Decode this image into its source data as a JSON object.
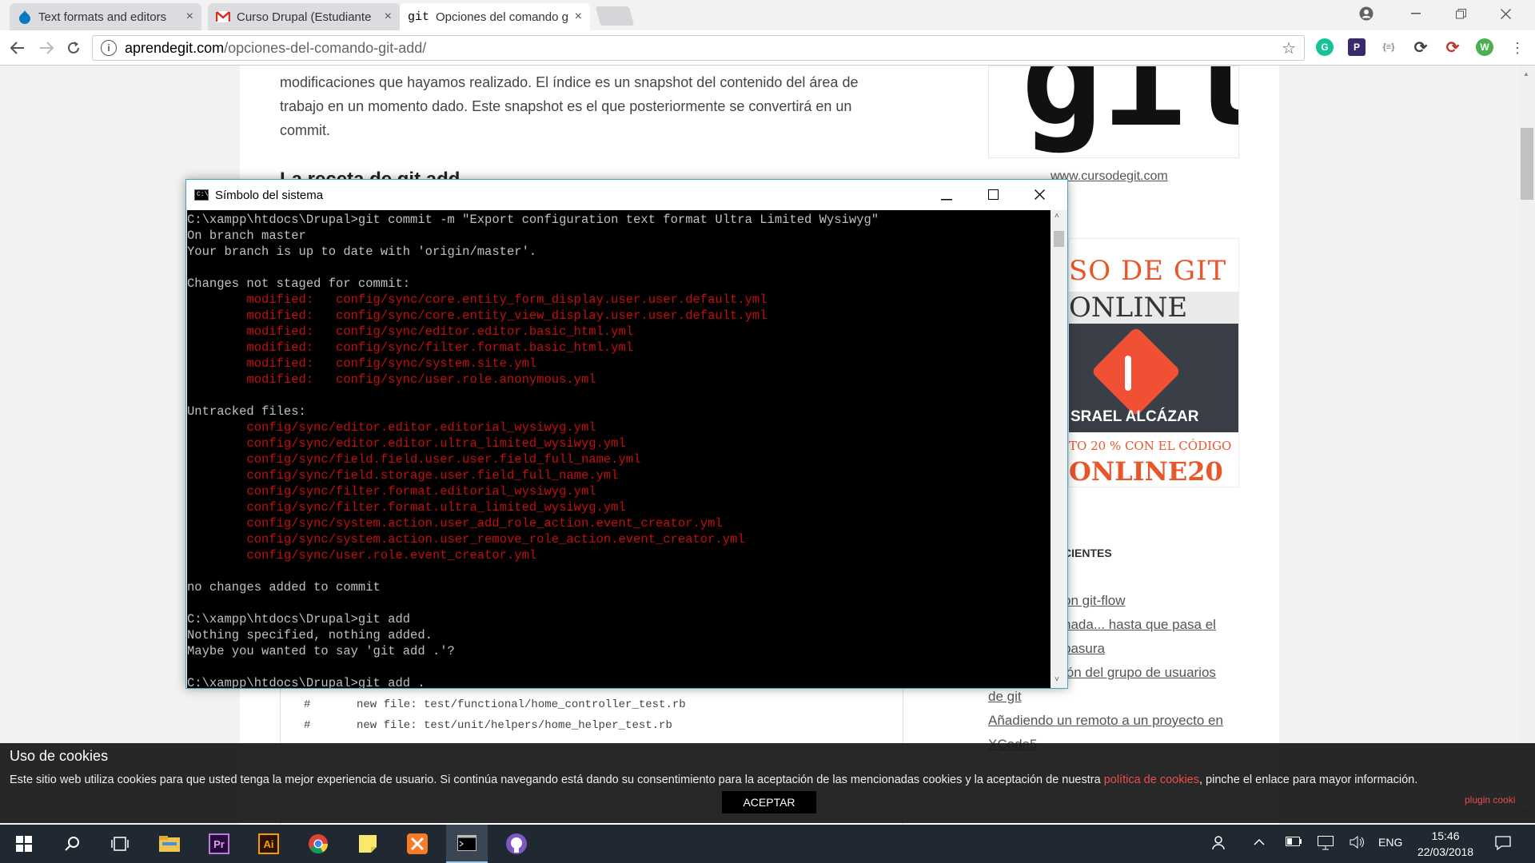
{
  "browser": {
    "tabs": [
      {
        "title": "Text formats and editors",
        "favicon": "drupal-icon",
        "color": "#0678be"
      },
      {
        "title": "Curso Drupal (Estudiante",
        "favicon": "gmail-icon",
        "color": "#d93025"
      },
      {
        "title": "Opciones del comando git",
        "favicon": "git-icon",
        "prefix": "git",
        "active": true
      }
    ],
    "close_glyph": "×",
    "url_host": "aprendegit.com",
    "url_path": "/opciones-del-comando-git-add/",
    "extensions": [
      {
        "name": "grammarly-icon",
        "glyph": "G",
        "color": "#15c39a"
      },
      {
        "name": "p-extension-icon",
        "glyph": "P",
        "color": "#3b2a6b"
      },
      {
        "name": "json-icon",
        "glyph": "{≡}",
        "color": "#888"
      },
      {
        "name": "sync-icon",
        "glyph": "⟳",
        "color": "#555"
      },
      {
        "name": "sync-red-icon",
        "glyph": "⟳",
        "color": "#c0392b"
      },
      {
        "name": "wordpress-icon",
        "glyph": "W",
        "color": "#4caf50"
      }
    ]
  },
  "article": {
    "lines": [
      "modificaciones que hayamos realizado. El índice es un snapshot del contenido del área de",
      "trabajo en un momento dado. Este snapshot es el que posteriormente se convertirá en un",
      "commit."
    ],
    "heading_partial": "La receta de git add",
    "code_lines": [
      {
        "hash": "#",
        "text": "new file: test/functional/home_controller_test.rb"
      },
      {
        "hash": "#",
        "text": "new file: test/unit/helpers/home_helper_test.rb"
      },
      {
        "hash": "#",
        "text": ""
      }
    ]
  },
  "sidebar": {
    "logo_text": "git",
    "site_link": "www.cursodegit.com",
    "promo": {
      "line1": "SO DE GIT",
      "line2": "ONLINE",
      "author": "SRAEL ALCÁZAR",
      "discount": "TO 20 % CON EL CÓDIGO",
      "code": "ONLINE20"
    },
    "section_title": "CIENTES",
    "links": [
      "on git-flow",
      "nada... hasta que pasa el",
      "basura",
      "ión del grupo de usuarios",
      "de git",
      "Añadiendo un remoto a un proyecto en",
      "XCode5"
    ]
  },
  "cookie": {
    "title": "Uso de cookies",
    "text_before": "Este sitio web utiliza cookies para que usted tenga la mejor experiencia de usuario. Si continúa navegando está dando su consentimiento para la aceptación de las mencionadas cookies y la aceptación de nuestra ",
    "link": "política de cookies",
    "text_after": ", pinche el enlace para mayor información.",
    "accept": "ACEPTAR",
    "plugin": "plugin cooki",
    "link_color": "#e94d4d"
  },
  "console": {
    "title": "Símbolo del sistema",
    "lines": [
      {
        "text": "C:\\xampp\\htdocs\\Drupal>git commit -m \"Export configuration text format Ultra Limited Wysiwyg\"",
        "red": false
      },
      {
        "text": "On branch master",
        "red": false
      },
      {
        "text": "Your branch is up to date with 'origin/master'.",
        "red": false
      },
      {
        "text": "",
        "red": false
      },
      {
        "text": "Changes not staged for commit:",
        "red": false
      },
      {
        "text": "        modified:   config/sync/core.entity_form_display.user.user.default.yml",
        "red": true
      },
      {
        "text": "        modified:   config/sync/core.entity_view_display.user.user.default.yml",
        "red": true
      },
      {
        "text": "        modified:   config/sync/editor.editor.basic_html.yml",
        "red": true
      },
      {
        "text": "        modified:   config/sync/filter.format.basic_html.yml",
        "red": true
      },
      {
        "text": "        modified:   config/sync/system.site.yml",
        "red": true
      },
      {
        "text": "        modified:   config/sync/user.role.anonymous.yml",
        "red": true
      },
      {
        "text": "",
        "red": false
      },
      {
        "text": "Untracked files:",
        "red": false
      },
      {
        "text": "        config/sync/editor.editor.editorial_wysiwyg.yml",
        "red": true
      },
      {
        "text": "        config/sync/editor.editor.ultra_limited_wysiwyg.yml",
        "red": true
      },
      {
        "text": "        config/sync/field.field.user.user.field_full_name.yml",
        "red": true
      },
      {
        "text": "        config/sync/field.storage.user.field_full_name.yml",
        "red": true
      },
      {
        "text": "        config/sync/filter.format.editorial_wysiwyg.yml",
        "red": true
      },
      {
        "text": "        config/sync/filter.format.ultra_limited_wysiwyg.yml",
        "red": true
      },
      {
        "text": "        config/sync/system.action.user_add_role_action.event_creator.yml",
        "red": true
      },
      {
        "text": "        config/sync/system.action.user_remove_role_action.event_creator.yml",
        "red": true
      },
      {
        "text": "        config/sync/user.role.event_creator.yml",
        "red": true
      },
      {
        "text": "",
        "red": false
      },
      {
        "text": "no changes added to commit",
        "red": false
      },
      {
        "text": "",
        "red": false
      },
      {
        "text": "C:\\xampp\\htdocs\\Drupal>git add",
        "red": false
      },
      {
        "text": "Nothing specified, nothing added.",
        "red": false
      },
      {
        "text": "Maybe you wanted to say 'git add .'?",
        "red": false
      },
      {
        "text": "",
        "red": false
      },
      {
        "text": "C:\\xampp\\htdocs\\Drupal>git add .",
        "red": false
      }
    ]
  },
  "taskbar": {
    "apps": [
      "windows-start-icon",
      "search-icon",
      "task-view-icon",
      "file-explorer-icon",
      "premiere-icon",
      "illustrator-icon",
      "chrome-icon",
      "sticky-notes-icon",
      "xampp-icon",
      "cmd-icon",
      "github-icon"
    ],
    "app_labels": {
      "premiere": "Pr",
      "illustrator": "Ai"
    },
    "lang": "ENG",
    "time": "15:46",
    "date": "22/03/2018"
  }
}
